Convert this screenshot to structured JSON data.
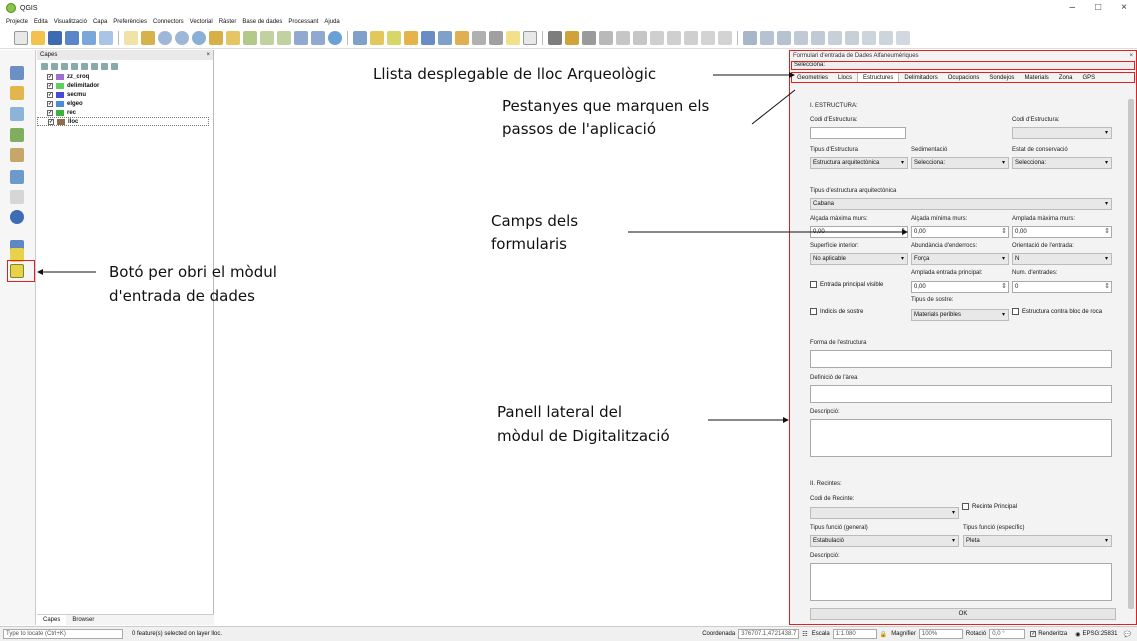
{
  "window": {
    "title": "QGIS"
  },
  "menu": [
    "Projecte",
    "Edita",
    "Visualització",
    "Capa",
    "Preferències",
    "Connectors",
    "Vectorial",
    "Ràster",
    "Base de dades",
    "Processant",
    "Ajuda"
  ],
  "layers_panel": {
    "title": "Capes",
    "items": [
      {
        "name": "zz_croq",
        "color": "#9c6fd1"
      },
      {
        "name": "delimitador",
        "color": "#5bd35b"
      },
      {
        "name": "secmu",
        "color": "#4a4ad8"
      },
      {
        "name": "elgeo",
        "color": "#4b8ed8"
      },
      {
        "name": "rec",
        "color": "#3ab43a"
      },
      {
        "name": "lloc",
        "color": "#8d6e4a"
      }
    ],
    "tabs": [
      "Capes",
      "Browser"
    ]
  },
  "dock": {
    "title": "Formulari d'entrada de Dades Alfaneumèriques",
    "selector": "Selecciona:",
    "tabs": [
      "Geometries",
      "Llocs",
      "Estructures",
      "Delimitadors",
      "Ocupacions",
      "Sondejos",
      "Materials",
      "Zona",
      "GPS"
    ],
    "form": {
      "section1": "I. ESTRUCTURA:",
      "codi_estructura": "Codi d'Estructura:",
      "codi_estructura2": "Codi d'Estructura:",
      "tipus_estructura": "Tipus d'Estructura",
      "tipus_estructura_val": "Estructura arquitectònica",
      "sedimentacio": "Sedimentació",
      "sedimentacio_val": "Selecciona:",
      "estat_conservacio": "Estat de conservació",
      "estat_conservacio_val": "Selecciona:",
      "tipus_arq": "Tipus d'estructura arquitectònica",
      "tipus_arq_val": "Cabana",
      "alcada_max": "Alçada màxima murs:",
      "alcada_min": "Alçada mínima murs:",
      "amplada_max": "Amplada màxima murs:",
      "zero": "0,00",
      "superficie": "Superfície interior:",
      "superficie_val": "No aplicable",
      "abundancia": "Abundància d'enderrocs:",
      "abundancia_val": "Força",
      "orientacio": "Orientació de l'entrada:",
      "orientacio_val": "N",
      "entrada_visible": "Entrada principal visible",
      "amplada_entrada": "Amplada entrada principal:",
      "num_entrades": "Num. d'entrades:",
      "num_entrades_val": "0",
      "indicis_sostre": "Indicis de sostre",
      "tipus_sostre": "Tipus de sostre:",
      "tipus_sostre_val": "Materials peribles",
      "contra_roca": "Estructura contra bloc de roca",
      "forma": "Forma de l'estructura",
      "definicio_area": "Definició de l'àrea",
      "descripcio": "Descripció:",
      "section2": "II. Recintes:",
      "codi_recinte": "Codi de Recinte:",
      "recinte_principal": "Recinte Principal",
      "tipus_funcio_general": "Tipus funció (general)",
      "tipus_funcio_general_val": "Estabulació",
      "tipus_funcio_especific": "Tipus funció (específic)",
      "tipus_funcio_especific_val": "Pleta",
      "descripcio2": "Descripció:"
    },
    "ok": "OK"
  },
  "annotations": {
    "llista": "Llista desplegable de lloc Arqueològic",
    "pestanyes_1": "Pestanyes que marquen els",
    "pestanyes_2": "passos de l'aplicació",
    "camps_1": "Camps dels",
    "camps_2": "formularis",
    "boto_1": "Botó per obri el mòdul",
    "boto_2": "d'entrada de dades",
    "panell_1": "Panell lateral del",
    "panell_2": "mòdul de Digitalització"
  },
  "status": {
    "locate": "Type to locate (Ctrl+K)",
    "features": "0 feature(s) selected on layer lloc.",
    "coord_label": "Coordenada",
    "coord": "376707.1,4721438.7",
    "scale_label": "Escala",
    "scale": "1:1.080",
    "magnifier_label": "Magnifier",
    "magnifier": "100%",
    "rotation_label": "Rotació",
    "rotation": "0,0 °",
    "render": "Renderitza",
    "crs": "EPSG:25831"
  }
}
